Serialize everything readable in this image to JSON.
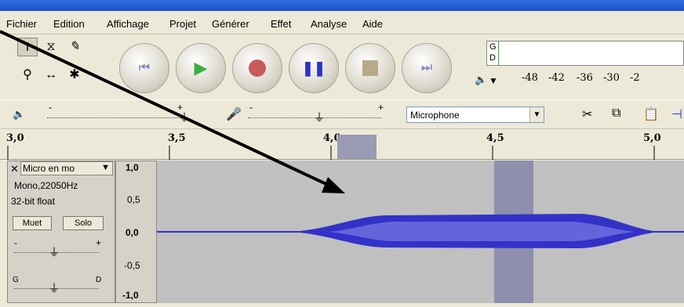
{
  "menu": [
    "Fichier",
    "Edition",
    "Affichage",
    "Projet",
    "Générer",
    "Effet",
    "Analyse",
    "Aide"
  ],
  "meter": {
    "channel_top": "G",
    "channel_bottom": "D",
    "ticks": [
      "-48",
      "-42",
      "-36",
      "-30",
      "-2"
    ]
  },
  "mixer": {
    "input_source": "Microphone",
    "slider_minus": "-",
    "slider_plus": "+"
  },
  "ruler": {
    "labels": [
      "3,0",
      "3,5",
      "4,0",
      "4,5",
      "5,0"
    ]
  },
  "track": {
    "name": "Micro en mo",
    "format": "Mono,22050Hz",
    "bitdepth": "32-bit float",
    "mute": "Muet",
    "solo": "Solo",
    "gain_minus": "-",
    "gain_plus": "+",
    "pan_left": "G",
    "pan_right": "D"
  },
  "vruler": [
    "1,0",
    "0,5",
    "0,0",
    "-0,5",
    "-1,0"
  ],
  "colors": {
    "waveform": "#3232c8",
    "waveform_rms": "#6464dc",
    "selection": "#8d8fac",
    "arrow": "#000000"
  }
}
